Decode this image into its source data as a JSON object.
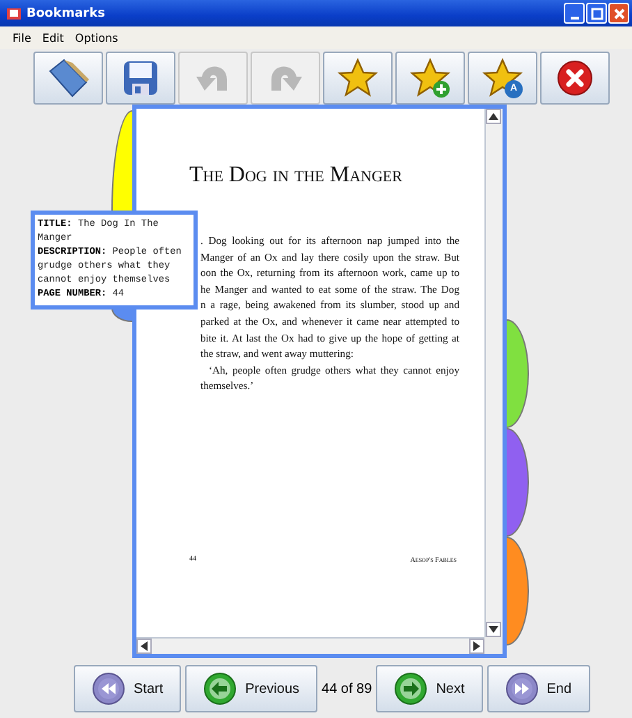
{
  "window": {
    "title": "Bookmarks"
  },
  "menu": [
    "File",
    "Edit",
    "Options"
  ],
  "toolbar": [
    {
      "kind": "open",
      "disabled": false
    },
    {
      "kind": "save",
      "disabled": false
    },
    {
      "kind": "undo",
      "disabled": true
    },
    {
      "kind": "redo",
      "disabled": true
    },
    {
      "kind": "star",
      "disabled": false
    },
    {
      "kind": "star-add",
      "disabled": false
    },
    {
      "kind": "star-badge",
      "badge": "A",
      "disabled": false
    },
    {
      "kind": "close",
      "disabled": false
    }
  ],
  "left_tabs": [
    {
      "color": "#ffff00"
    },
    {
      "color": "#5b8cf0"
    }
  ],
  "right_tabs": [
    {
      "color": "#80e040"
    },
    {
      "color": "#9060f0"
    },
    {
      "color": "#ff8c20"
    }
  ],
  "page": {
    "title": "The Dog in the Manger",
    "lines": [
      ". Dog looking out for its afternoon nap jumped into the",
      "Manger of an Ox and lay there cosily upon the straw. But",
      "oon the Ox, returning from its afternoon work, came up to",
      "he Manger and wanted to eat some of the straw. The Dog",
      "n a rage, being awakened from its slumber, stood up and",
      "parked at the Ox, and whenever it came near attempted to",
      "bite it. At last the Ox had to give up the hope of getting at",
      "the straw, and went away muttering:"
    ],
    "last_lines": [
      "‘Ah, people often grudge others what they cannot enjoy",
      "themselves.’"
    ],
    "page_number": "44",
    "running_head": "Aesop's Fables"
  },
  "tooltip": [
    "**TITLE:** The Dog In The Manger",
    "**DESCRIPTION:** People often grudge others what they cannot enjoy themselves",
    "**PAGE NUMBER:** 44"
  ],
  "nav": [
    {
      "kind": "start",
      "label": "Start"
    },
    {
      "kind": "previous",
      "label": "Previous"
    },
    {
      "kind": "counter",
      "label": "44 of 89"
    },
    {
      "kind": "next",
      "label": "Next"
    },
    {
      "kind": "end",
      "label": "End"
    }
  ]
}
